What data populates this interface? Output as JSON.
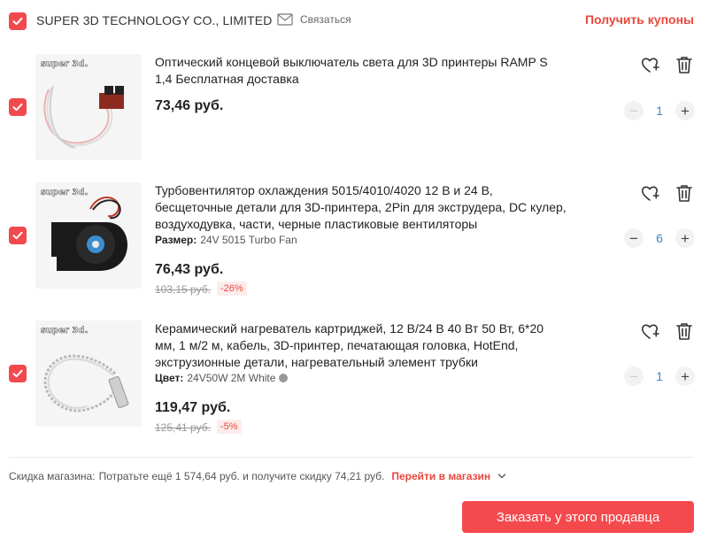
{
  "header": {
    "seller_name": "SUPER 3D TECHNOLOGY CO., LIMITED",
    "contact_label": "Связаться",
    "coupons_label": "Получить купоны"
  },
  "items": [
    {
      "title": "Оптический концевой выключатель света для 3D принтеры RAMP S 1,4 Бесплатная доставка",
      "price": "73,46 руб.",
      "quantity": "1",
      "minus_enabled": false,
      "thumb_watermark": "super 3d."
    },
    {
      "title": "Турбовентилятор охлаждения 5015/4010/4020 12 В и 24 В, бесщеточные детали для 3D-принтера, 2Pin для экструдера, DC кулер, воздуходувка, части, черные пластиковые вентиляторы",
      "variant_label": "Размер:",
      "variant_value": "24V 5015 Turbo Fan",
      "price": "76,43 руб.",
      "old_price": "103,15 руб.",
      "discount": "-26%",
      "quantity": "6",
      "minus_enabled": true,
      "thumb_watermark": "super 3d."
    },
    {
      "title": "Керамический нагреватель картриджей, 12 В/24 В 40 Вт 50 Вт, 6*20 мм, 1 м/2 м, кабель, 3D-принтер, печатающая головка, HotEnd, экструзионные детали, нагревательный элемент трубки",
      "variant_label": "Цвет:",
      "variant_value": "24V50W 2M White",
      "price": "119,47 руб.",
      "old_price": "125,41 руб.",
      "discount": "-5%",
      "quantity": "1",
      "minus_enabled": false,
      "thumb_watermark": "super 3d."
    }
  ],
  "store_discount": {
    "label": "Скидка магазина:",
    "text": "Потратьте ещё 1 574,64 руб. и получите скидку 74,21 руб.",
    "link": "Перейти в магазин"
  },
  "order_button": "Заказать у этого продавца",
  "colors": {
    "accent": "#f04a4f",
    "link_red": "#e8483f",
    "qty_blue": "#3a87c9"
  }
}
